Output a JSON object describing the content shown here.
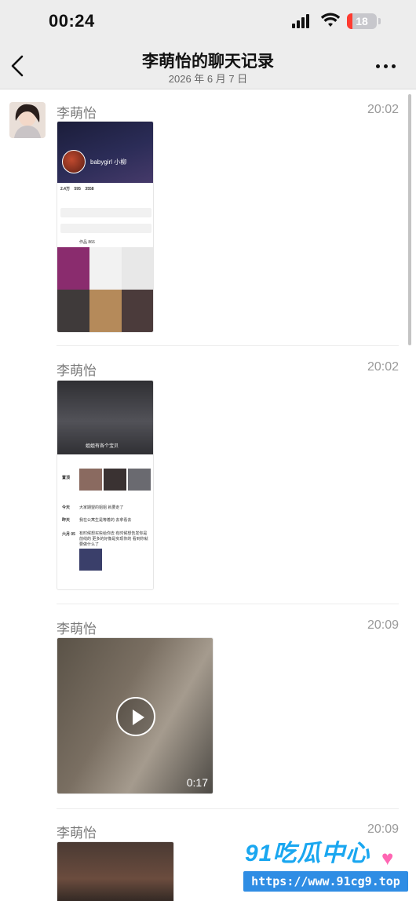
{
  "status_bar": {
    "time": "00:24",
    "battery": "18",
    "battery_level": 0.18
  },
  "nav": {
    "title": "李萌怡的聊天记录",
    "subtitle": "2026 年 6 月 7 日"
  },
  "messages": [
    {
      "name": "李萌怡",
      "time": "20:02",
      "type": "image",
      "content": {
        "profile_name": "babygirl 小柳",
        "stats": [
          "2.4万",
          "595",
          "3558"
        ],
        "tab": "作品 866"
      }
    },
    {
      "name": "李萌怡",
      "time": "20:02",
      "type": "image",
      "content": {
        "header_caption": "姐姐有各个宝贝",
        "rows": [
          {
            "label": "置顶",
            "text": ""
          },
          {
            "label": "今天",
            "text": "大家期望的姐姐 就要走了"
          },
          {
            "label": "昨天",
            "text": "我在公寓生是等着的 去拿看去"
          },
          {
            "label": "六月 05",
            "text": "有时候想买些给你去 有时候想告发你是前线的 更多的好像是实现你的 看到你就要做什么了"
          }
        ]
      }
    },
    {
      "name": "李萌怡",
      "time": "20:09",
      "type": "video",
      "duration": "0:17"
    },
    {
      "name": "李萌怡",
      "time": "20:09",
      "type": "image"
    }
  ],
  "watermark": {
    "logo": "91吃瓜中心",
    "url": "https://www.91cg9.top"
  },
  "colors": {
    "nav_bg": "#ededed",
    "meta_text": "#7b7b7b",
    "watermark": "#1aa7f0"
  }
}
